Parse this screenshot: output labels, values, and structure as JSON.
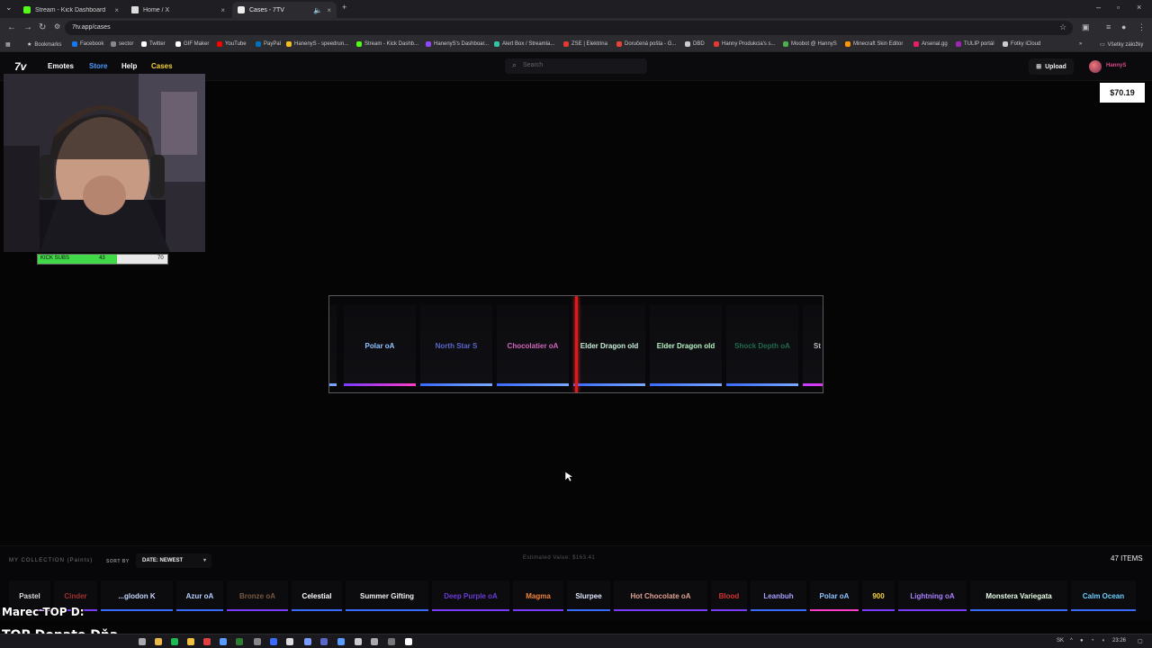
{
  "browser": {
    "tabs": [
      {
        "title": "Stream - Kick Dashboard",
        "icon": "kick-icon",
        "color": "#53fc18"
      },
      {
        "title": "Home / X",
        "icon": "x-icon",
        "color": "#ffffff"
      },
      {
        "title": "Cases - 7TV",
        "icon": "7tv-icon",
        "color": "#ffffff"
      }
    ],
    "new_tab": "+",
    "url": "7tv.app/cases",
    "bookmarks_label": "Bookmarks",
    "bookmarks": [
      {
        "label": "Facebook",
        "color": "#1877f2"
      },
      {
        "label": "sector",
        "color": "#888888"
      },
      {
        "label": "Twitter",
        "color": "#ffffff"
      },
      {
        "label": "GIF Maker",
        "color": "#ffffff"
      },
      {
        "label": "YouTube",
        "color": "#ff0000"
      },
      {
        "label": "PayPal",
        "color": "#0070ba"
      },
      {
        "label": "HanenyS - speedrun...",
        "color": "#f4c020"
      },
      {
        "label": "Stream - Kick Dashb...",
        "color": "#53fc18"
      },
      {
        "label": "HanenyS's Dashboar...",
        "color": "#9146ff"
      },
      {
        "label": "Alert Box / Streamla...",
        "color": "#31c3a2"
      },
      {
        "label": "ZSE | Elektrina",
        "color": "#e53935"
      },
      {
        "label": "Doručená pošta - G...",
        "color": "#ea4335"
      },
      {
        "label": "DBD",
        "color": "#cccccc"
      },
      {
        "label": "Hanny Produkcia's s...",
        "color": "#e53935"
      },
      {
        "label": "Moobot @ HannyS",
        "color": "#4caf50"
      },
      {
        "label": "Minecraft Skin Editor",
        "color": "#ff9800"
      },
      {
        "label": "Arsenal.gg",
        "color": "#e91e63"
      },
      {
        "label": "TULIP portál",
        "color": "#9c27b0"
      },
      {
        "label": "Fotky iCloud",
        "color": "#cccccc"
      }
    ],
    "all_bookmarks": "Všetky záložky"
  },
  "site": {
    "logo": "7v",
    "nav": [
      {
        "label": "Emotes",
        "color": "#ffffff"
      },
      {
        "label": "Store",
        "color": "#4b9bff"
      },
      {
        "label": "Help",
        "color": "#ffffff"
      },
      {
        "label": "Cases",
        "color": "#f5d33a"
      }
    ],
    "search_placeholder": "Search",
    "upload_label": "Upload",
    "username": "HannyS",
    "balance": "$70.19"
  },
  "stream_overlay": {
    "subs_label": "KICK SUBS",
    "subs_current": "43",
    "subs_goal": "70",
    "subs_progress": 0.614,
    "donor_line1": "Marec TOP D:",
    "donor_line2": "TOP Donate Dňa -"
  },
  "spinner": {
    "items": [
      {
        "label": "Polar oA",
        "text_color": "#8ec5ff",
        "bar": "linear-gradient(90deg,#7a3cff,#ff3cc8)"
      },
      {
        "label": "North Star S",
        "text_color": "#5a66c8",
        "bar": "linear-gradient(90deg,#3a6bff,#7aa8ff)"
      },
      {
        "label": "Chocolatier oA",
        "text_color": "#d066b8",
        "bar": "linear-gradient(90deg,#3a6bff,#7aa8ff)"
      },
      {
        "label": "Elder Dragon old",
        "text_color": "#c8f0d8",
        "bar": "linear-gradient(90deg,#3a6bff,#7aa8ff)"
      },
      {
        "label": "Elder Dragon old",
        "text_color": "#b8f2c6",
        "bar": "linear-gradient(90deg,#3a6bff,#7aa8ff)"
      },
      {
        "label": "Shock Depth oA",
        "text_color": "#1f6a4c",
        "bar": "linear-gradient(90deg,#3a6bff,#7aa8ff)"
      },
      {
        "label": "St",
        "text_color": "#bbbbbb",
        "bar": "linear-gradient(90deg,#c83cff,#ff3cc8)"
      }
    ]
  },
  "collection": {
    "title": "MY COLLECTION (Paints)",
    "sort_label": "SORT BY",
    "sort_value": "DATE: NEWEST",
    "estimated_value": "Estimated Value: $163.41",
    "item_count": "47 ITEMS",
    "items": [
      {
        "label": "Pastel",
        "color": "#dcdcdc",
        "bar": "#d6a4ff"
      },
      {
        "label": "Cinder",
        "color": "#a23030",
        "bar": "#7a3cff"
      },
      {
        "label": "...glodon K",
        "color": "#c8d8ff",
        "bar": "#3a6bff"
      },
      {
        "label": "Azur oA",
        "color": "#b8cfff",
        "bar": "#3a6bff"
      },
      {
        "label": "Bronze oA",
        "color": "#7a5a40",
        "bar": "#7a3cff"
      },
      {
        "label": "Celestial",
        "color": "#ffffff",
        "bar": "#3a6bff"
      },
      {
        "label": "Summer Gifting",
        "color": "#f0f0f0",
        "bar": "#3a6bff"
      },
      {
        "label": "Deep Purple oA",
        "color": "#6a3ad8",
        "bar": "#7a3cff"
      },
      {
        "label": "Magma",
        "color": "#f0843a",
        "bar": "#7a3cff"
      },
      {
        "label": "Slurpee",
        "color": "#dfe8ff",
        "bar": "#3a6bff"
      },
      {
        "label": "Hot Chocolate oA",
        "color": "#e0a090",
        "bar": "#7a3cff"
      },
      {
        "label": "Blood",
        "color": "#d83030",
        "bar": "#7a3cff"
      },
      {
        "label": "Leanbuh",
        "color": "#a8a0ff",
        "bar": "#3a6bff"
      },
      {
        "label": "Polar oA",
        "color": "#8ec5ff",
        "bar": "#ff3cc8"
      },
      {
        "label": "900",
        "color": "#f5d33a",
        "bar": "#7a3cff"
      },
      {
        "label": "Lightning oA",
        "color": "#a880ff",
        "bar": "#7a3cff"
      },
      {
        "label": "Monstera Variegata",
        "color": "#e8ffe8",
        "bar": "#3a6bff"
      },
      {
        "label": "Calm Ocean",
        "color": "#6ad0ff",
        "bar": "#3a6bff"
      }
    ]
  },
  "taskbar": {
    "lang": "SK",
    "time": "23:26"
  }
}
